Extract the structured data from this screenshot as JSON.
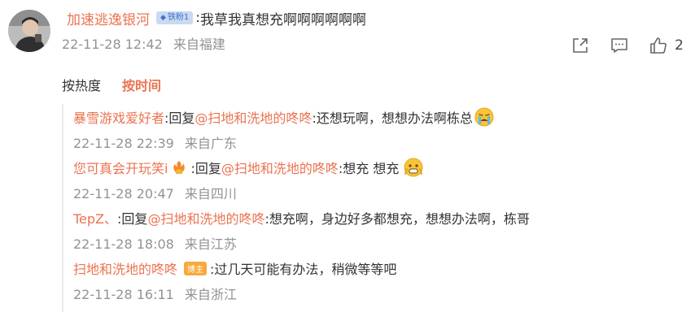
{
  "comment": {
    "username": "加速逃逸银河",
    "fan_badge": "铁粉1",
    "colon": ":",
    "text": "我草我真想充啊啊啊啊啊啊",
    "date": "22-11-28 12:42",
    "location": "来自福建",
    "actions": {
      "share_icon": "share-icon",
      "comment_icon": "comment-icon",
      "like_icon": "thumb-up-icon",
      "like_count": "2"
    }
  },
  "sort": {
    "by_hot": "按热度",
    "by_time": "按时间",
    "active": "by_time"
  },
  "replies": [
    {
      "name": "暴雪游戏爱好者",
      "prefix": ":回复",
      "mention": "@扫地和洗地的咚咚",
      "text": ":还想玩啊，想想办法啊栋总",
      "emoji": "crying-face-emoji",
      "date": "22-11-28 22:39",
      "location": "来自广东"
    },
    {
      "name": "您可真会开玩笑i",
      "name_emoji": "fire-hands-emoji",
      "prefix": ":回复",
      "mention": "@扫地和洗地的咚咚",
      "text": ":想充 想充",
      "emoji": "nervous-face-emoji",
      "date": "22-11-28 20:47",
      "location": "来自四川"
    },
    {
      "name": "TepZ、",
      "prefix": ":回复",
      "mention": "@扫地和洗地的咚咚",
      "text": ":想充啊，身边好多都想充，想想办法啊，栋哥",
      "date": "22-11-28 18:08",
      "location": "来自江苏"
    },
    {
      "name": "扫地和洗地的咚咚",
      "badge": "博主",
      "text": ":过几天可能有办法，稍微等等吧",
      "date": "22-11-28 16:11",
      "location": "来自浙江"
    }
  ],
  "colors": {
    "accent": "#eb7350",
    "meta_text": "#939393",
    "fan_badge_bg": "#c9d9f2",
    "author_badge_bg": "#f7a93c"
  }
}
